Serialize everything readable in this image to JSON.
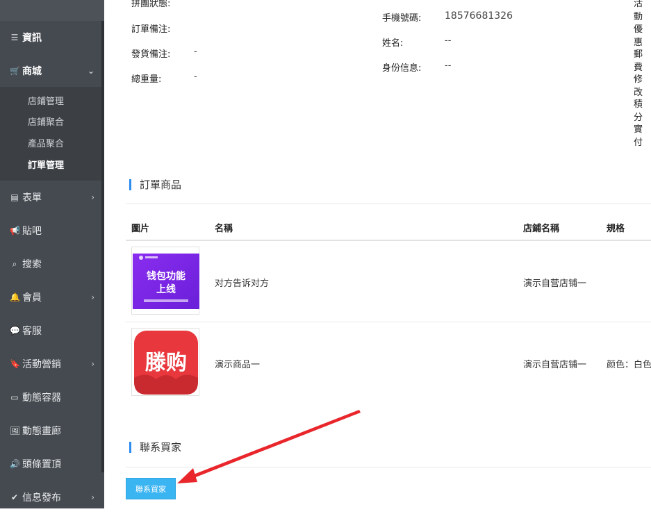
{
  "sidebar": {
    "items": [
      {
        "label": "資訊",
        "icon": "list-icon"
      },
      {
        "label": "商城",
        "icon": "cart-icon"
      },
      {
        "label": "表單",
        "icon": "table-icon"
      },
      {
        "label": "貼吧",
        "icon": "megaphone-icon"
      },
      {
        "label": "搜索",
        "icon": "search-icon"
      },
      {
        "label": "會員",
        "icon": "bell-icon"
      },
      {
        "label": "客服",
        "icon": "chat-icon"
      },
      {
        "label": "活動營銷",
        "icon": "bookmark-icon"
      },
      {
        "label": "動態容器",
        "icon": "inbox-icon"
      },
      {
        "label": "動態畫廊",
        "icon": "image-icon"
      },
      {
        "label": "頭條置頂",
        "icon": "volume-icon"
      },
      {
        "label": "信息發布",
        "icon": "check-icon"
      }
    ],
    "submenu": [
      "店鋪管理",
      "店鋪聚合",
      "產品聚合",
      "訂單管理"
    ]
  },
  "order_info": {
    "labels_left": [
      "拼團狀態:",
      "訂單備注:",
      "發貨備注:",
      "總重量:"
    ],
    "values_left": [
      "",
      "",
      "-",
      "-"
    ],
    "labels_mid": [
      "手機號碼:",
      "姓名:",
      "身份信息:"
    ],
    "values_mid": [
      "18576681326",
      "--",
      "--"
    ],
    "labels_right": [
      "活動",
      "優惠",
      "郵費",
      "修改",
      "積分",
      "實付"
    ]
  },
  "products_section": {
    "title": "訂單商品",
    "headers": [
      "圖片",
      "名稱",
      "店鋪名稱",
      "規格"
    ],
    "rows": [
      {
        "image_text_1": "钱包功能",
        "image_text_2": "上线",
        "name": "对方告诉对方",
        "shop": "演示自营店铺一",
        "spec": ""
      },
      {
        "image_text_1": "滕购",
        "image_text_2": "",
        "name": "演示商品一",
        "shop": "演示自营店铺一",
        "spec": "颜色：白色"
      }
    ]
  },
  "contact_section": {
    "title": "聯系買家",
    "button_label": "聯系買家"
  },
  "colors": {
    "accent": "#3bb4f2",
    "sidebar": "#454a50",
    "title_bar": "#2d8cf0",
    "product_red": "#e8383d",
    "product_purple": "#7b2ff7"
  }
}
